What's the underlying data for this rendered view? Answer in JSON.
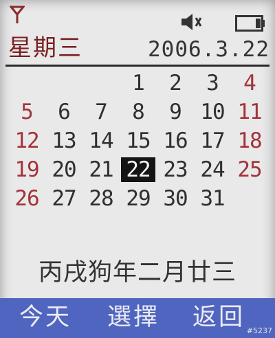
{
  "status": {
    "signal_icon": "signal-antenna-icon",
    "speaker_icon": "speaker-muted-icon",
    "battery_icon": "battery-icon"
  },
  "header": {
    "weekday": "星期三",
    "date": "2006.3.22"
  },
  "calendar": {
    "rows": [
      [
        "",
        "",
        "",
        "1",
        "2",
        "3",
        "4"
      ],
      [
        "5",
        "6",
        "7",
        "8",
        "9",
        "10",
        "11"
      ],
      [
        "12",
        "13",
        "14",
        "15",
        "16",
        "17",
        "18"
      ],
      [
        "19",
        "20",
        "21",
        "22",
        "23",
        "24",
        "25"
      ],
      [
        "26",
        "27",
        "28",
        "29",
        "30",
        "31",
        ""
      ]
    ],
    "today": "22",
    "weekend_color": "#a3333a"
  },
  "lunar_date": "丙戌狗年二月廿三",
  "softkeys": {
    "left": "今天",
    "center": "選擇",
    "right": "返回",
    "bar_color": "#4f65bf"
  },
  "watermark": "#5237"
}
